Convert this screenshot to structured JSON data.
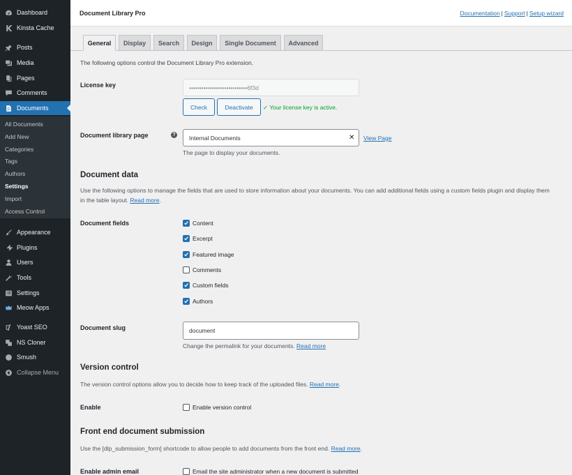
{
  "sidebar": {
    "items": [
      {
        "label": "Dashboard",
        "icon": "dashboard-icon"
      },
      {
        "label": "Kinsta Cache",
        "icon": "kinsta-icon"
      },
      {
        "label": "Posts",
        "icon": "pin-icon"
      },
      {
        "label": "Media",
        "icon": "media-icon"
      },
      {
        "label": "Pages",
        "icon": "pages-icon"
      },
      {
        "label": "Comments",
        "icon": "comments-icon"
      },
      {
        "label": "Documents",
        "icon": "document-icon"
      },
      {
        "label": "Appearance",
        "icon": "brush-icon"
      },
      {
        "label": "Plugins",
        "icon": "plugin-icon"
      },
      {
        "label": "Users",
        "icon": "users-icon"
      },
      {
        "label": "Tools",
        "icon": "wrench-icon"
      },
      {
        "label": "Settings",
        "icon": "settings-icon"
      },
      {
        "label": "Meow Apps",
        "icon": "meow-icon"
      },
      {
        "label": "Yoast SEO",
        "icon": "yoast-icon"
      },
      {
        "label": "NS Cloner",
        "icon": "cloner-icon"
      },
      {
        "label": "Smush",
        "icon": "smush-icon"
      },
      {
        "label": "Collapse Menu",
        "icon": "collapse-icon"
      }
    ],
    "submenu": [
      "All Documents",
      "Add New",
      "Categories",
      "Tags",
      "Authors",
      "Settings",
      "Import",
      "Access Control"
    ]
  },
  "header": {
    "title": "Document Library Pro",
    "links": [
      "Documentation",
      "Support",
      "Setup wizard"
    ],
    "separator": "|"
  },
  "tabs": [
    "General",
    "Display",
    "Search",
    "Design",
    "Single Document",
    "Advanced"
  ],
  "intro": "The following options control the Document Library Pro extension.",
  "license": {
    "label": "License key",
    "value": "••••••••••••••••••••••••••••6f3d",
    "check_label": "Check",
    "deactivate_label": "Deactivate",
    "status": "✓ Your license key is active."
  },
  "library_page": {
    "label": "Document library page",
    "help": "?",
    "value": "Internal Documents",
    "clear": "✕",
    "view_link": "View Page",
    "desc": "The page to display your documents."
  },
  "document_data": {
    "heading": "Document data",
    "desc_line1": "Use the following options to manage the fields that are used to store information about your documents. You can add additional fields using a custom fields plugin and display them",
    "desc_line2": "in the table layout.",
    "read_more": "Read more",
    "dot": "."
  },
  "document_fields": {
    "label": "Document fields",
    "options": [
      {
        "label": "Content",
        "checked": true
      },
      {
        "label": "Excerpt",
        "checked": true
      },
      {
        "label": "Featured image",
        "checked": true
      },
      {
        "label": "Comments",
        "checked": false
      },
      {
        "label": "Custom fields",
        "checked": true
      },
      {
        "label": "Authors",
        "checked": true
      }
    ]
  },
  "slug": {
    "label": "Document slug",
    "value": "document",
    "desc": "Change the permalink for your documents.",
    "read_more": "Read more"
  },
  "version_control": {
    "heading": "Version control",
    "desc": "The version control options allow you to decide how to keep track of the uploaded files.",
    "read_more": "Read more",
    "dot": ".",
    "enable_label": "Enable",
    "checkbox_label": "Enable version control"
  },
  "frontend": {
    "heading": "Front end document submission",
    "desc": "Use the [dlp_submission_form] shortcode to allow people to add documents from the front end.",
    "read_more": "Read more",
    "dot": ".",
    "admin_email_label": "Enable admin email",
    "admin_email_checkbox": "Email the site administrator when a new document is submitted"
  },
  "colors": {
    "accent": "#2271b1",
    "sidebar": "#1d2327",
    "valid": "#00a32a"
  }
}
